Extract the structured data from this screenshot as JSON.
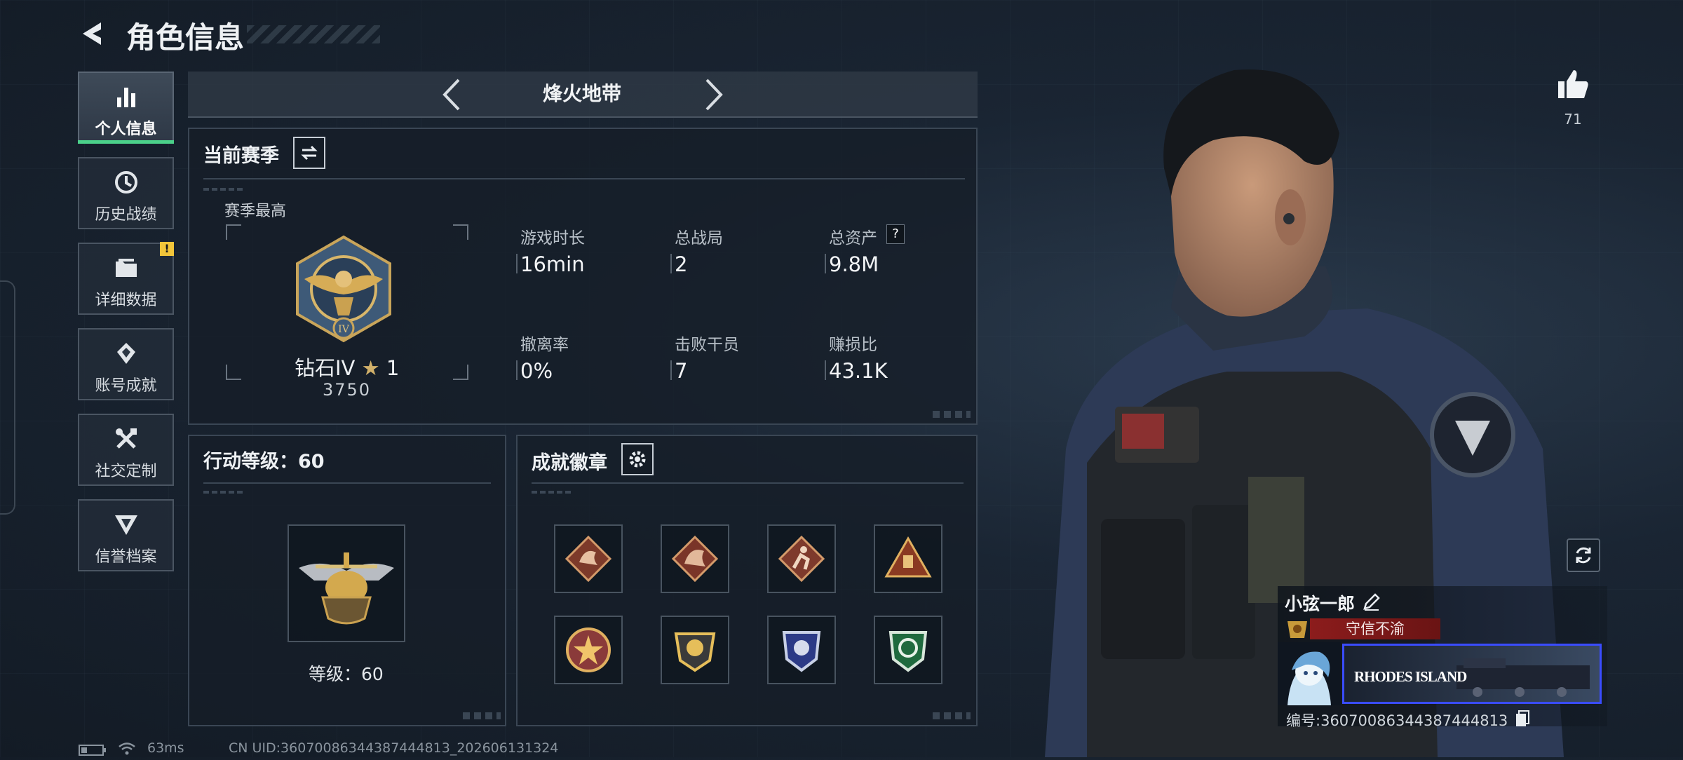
{
  "header": {
    "title": "角色信息"
  },
  "nav": [
    {
      "label": "个人信息",
      "icon": "bar-chart-icon"
    },
    {
      "label": "历史战绩",
      "icon": "clock-history-icon"
    },
    {
      "label": "详细数据",
      "icon": "folder-icon"
    },
    {
      "label": "账号成就",
      "icon": "achievement-icon"
    },
    {
      "label": "社交定制",
      "icon": "tools-icon"
    },
    {
      "label": "信誉档案",
      "icon": "reputation-icon"
    }
  ],
  "nav_alert": "!",
  "mode": {
    "name": "烽火地带"
  },
  "season": {
    "title": "当前赛季",
    "best_label": "赛季最高",
    "rank_name": "钻石IV",
    "rank_stars": "1",
    "rank_score": "3750",
    "stats": [
      {
        "label": "游戏时长",
        "value": "16min"
      },
      {
        "label": "总战局",
        "value": "2"
      },
      {
        "label": "总资产",
        "value": "9.8M"
      },
      {
        "label": "撤离率",
        "value": "0%"
      },
      {
        "label": "击败干员",
        "value": "7"
      },
      {
        "label": "赚损比",
        "value": "43.1K"
      }
    ],
    "help_glyph": "?"
  },
  "level": {
    "title": "行动等级：60",
    "caption": "等级：60"
  },
  "badges": {
    "title": "成就徽章",
    "items": [
      "dragon-badge-red",
      "dragon-badge-red-2",
      "runner-badge",
      "triangle-badge",
      "star-shield-badge",
      "gold-crest-badge",
      "blue-crest-badge",
      "green-crest-badge"
    ]
  },
  "likes": {
    "count": "71"
  },
  "player": {
    "name": "小弦一郎",
    "title_tag": "守信不渝",
    "banner_text": "RHODES ISLAND",
    "id_label": "编号:",
    "id_value": "3607008634438744481​3"
  },
  "footer": {
    "ping": "63ms",
    "uid": "CN UID:36070086344387444813_202606131324"
  },
  "colors": {
    "accent_green": "#4bd18a",
    "alert_yellow": "#f2c53a",
    "tag_red": "#8c1c1c"
  }
}
